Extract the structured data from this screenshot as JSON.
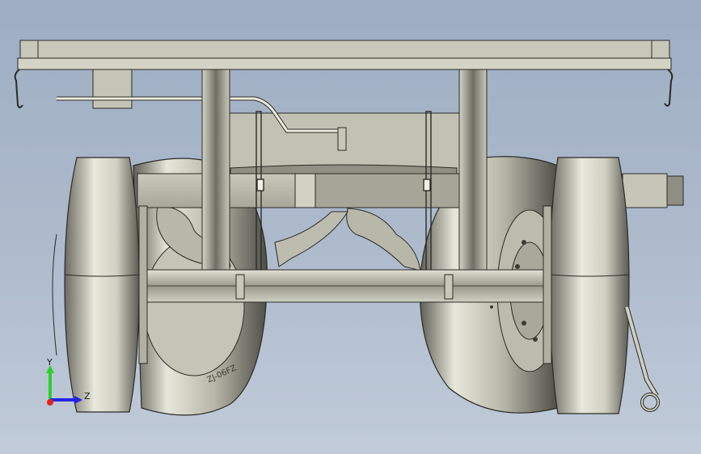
{
  "viewport": {
    "background_top": "#9eadc2",
    "background_bottom": "#c1cbd9"
  },
  "model": {
    "part_colors": {
      "steel": "#c8c8ba",
      "tire": "#d6d6c8",
      "outline": "#2b2b26"
    },
    "tire_text": "ZJ-06FZ"
  },
  "triad": {
    "y_label": "Y",
    "z_label": "Z",
    "y_color": "#2bd12b",
    "z_color": "#2323e6",
    "x_color": "#e62020"
  }
}
